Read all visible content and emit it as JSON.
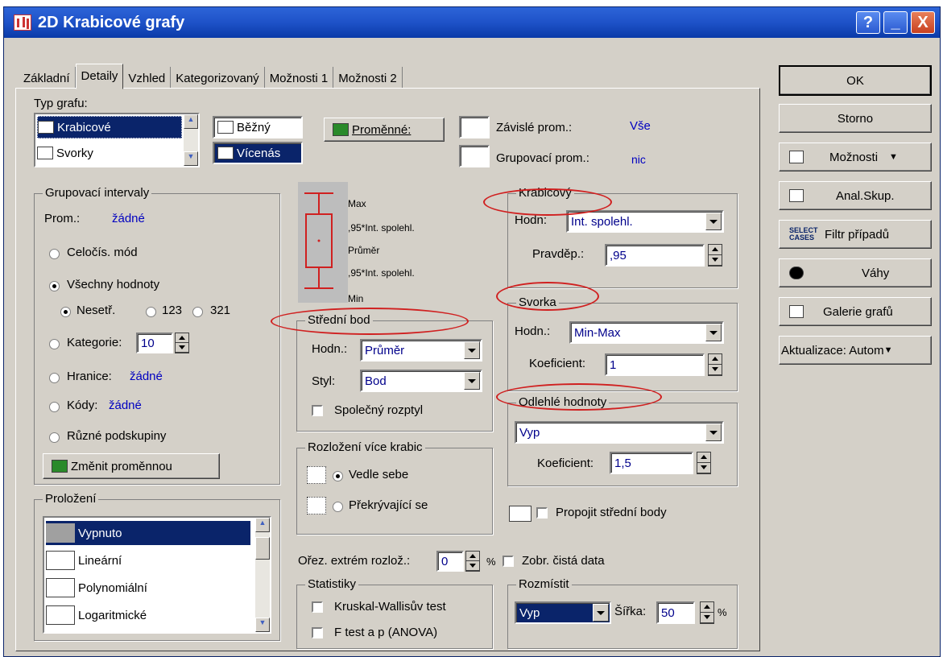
{
  "window": {
    "title": "2D Krabicové grafy"
  },
  "titlebar_buttons": {
    "help": "?",
    "minimize": "_",
    "close": "X"
  },
  "tabs": [
    "Základní",
    "Detaily",
    "Vzhled",
    "Kategorizovaný",
    "Možnosti 1",
    "Možnosti 2"
  ],
  "active_tab": "Detaily",
  "typ_grafu": {
    "label": "Typ grafu:",
    "list": [
      "Krabicové",
      "Svorky"
    ],
    "beh": "Běžný",
    "vicenas": "Vícenás",
    "promenne_btn": "Proměnné:",
    "zavisle_label": "Závislé prom.:",
    "zavisle_value": "Vše",
    "grupovaci_label": "Grupovací prom.:",
    "grupovaci_value": "nic"
  },
  "grupovaci_intervaly": {
    "title": "Grupovací intervaly",
    "prom_label": "Prom.:",
    "prom_value": "žádné",
    "celocis": "Celočís. mód",
    "vsechny": "Všechny hodnoty",
    "nesetr": "Nesetř.",
    "r123": "123",
    "r321": "321",
    "kategorie": "Kategorie:",
    "kategorie_value": "10",
    "hranice": "Hranice:",
    "hranice_value": "žádné",
    "kody": "Kódy:",
    "kody_value": "žádné",
    "ruzne": "Různé podskupiny",
    "zmenit_btn": "Změnit proměnnou"
  },
  "legend": {
    "max": "Max",
    "int_up": ",95*Int. spolehl.",
    "prumer": "Průměr",
    "int_down": ",95*Int. spolehl.",
    "min": "Min"
  },
  "stredni_bod": {
    "title": "Střední bod",
    "hodn_label": "Hodn.:",
    "hodn_value": "Průměr",
    "styl_label": "Styl:",
    "styl_value": "Bod",
    "spolecny": "Společný rozptyl"
  },
  "rozlozeni": {
    "title": "Rozložení více krabic",
    "vedle": "Vedle sebe",
    "prekryvajici": "Překrývající se"
  },
  "krabicovy": {
    "title": "Krabicový",
    "hodn_label": "Hodn:",
    "hodn_value": "Int. spolehl.",
    "pravdep_label": "Pravděp.:",
    "pravdep_value": ",95"
  },
  "svorka": {
    "title": "Svorka",
    "hodn_label": "Hodn.:",
    "hodn_value": "Min-Max",
    "koef_label": "Koeficient:",
    "koef_value": "1"
  },
  "odlehle": {
    "title": "Odlehlé hodnoty",
    "value": "Vyp",
    "koef_label": "Koeficient:",
    "koef_value": "1,5"
  },
  "propojit": "Propojit střední body",
  "prolozeni": {
    "title": "Proložení",
    "items": [
      "Vypnuto",
      "Lineární",
      "Polynomiální",
      "Logaritmické"
    ]
  },
  "orez": {
    "label": "Ořez. extrém rozlož.:",
    "value": "0",
    "unit": "%"
  },
  "zobr": "Zobr. čistá data",
  "statistiky": {
    "title": "Statistiky",
    "kruskal": "Kruskal-Wallisův test",
    "ftest": "F test a p (ANOVA)"
  },
  "rozmistit": {
    "title": "Rozmístit",
    "value": "Vyp",
    "sirka_label": "Šířka:",
    "sirka_value": "50",
    "unit": "%"
  },
  "right_buttons": {
    "ok": "OK",
    "storno": "Storno",
    "moznosti": "Možnosti",
    "anal": "Anal.Skup.",
    "filtr": "Filtr případů",
    "filtr_icon_text": "SELECT CASES",
    "vahy": "Váhy",
    "galerie": "Galerie grafů",
    "aktualizace": "Aktualizace: Autom"
  }
}
